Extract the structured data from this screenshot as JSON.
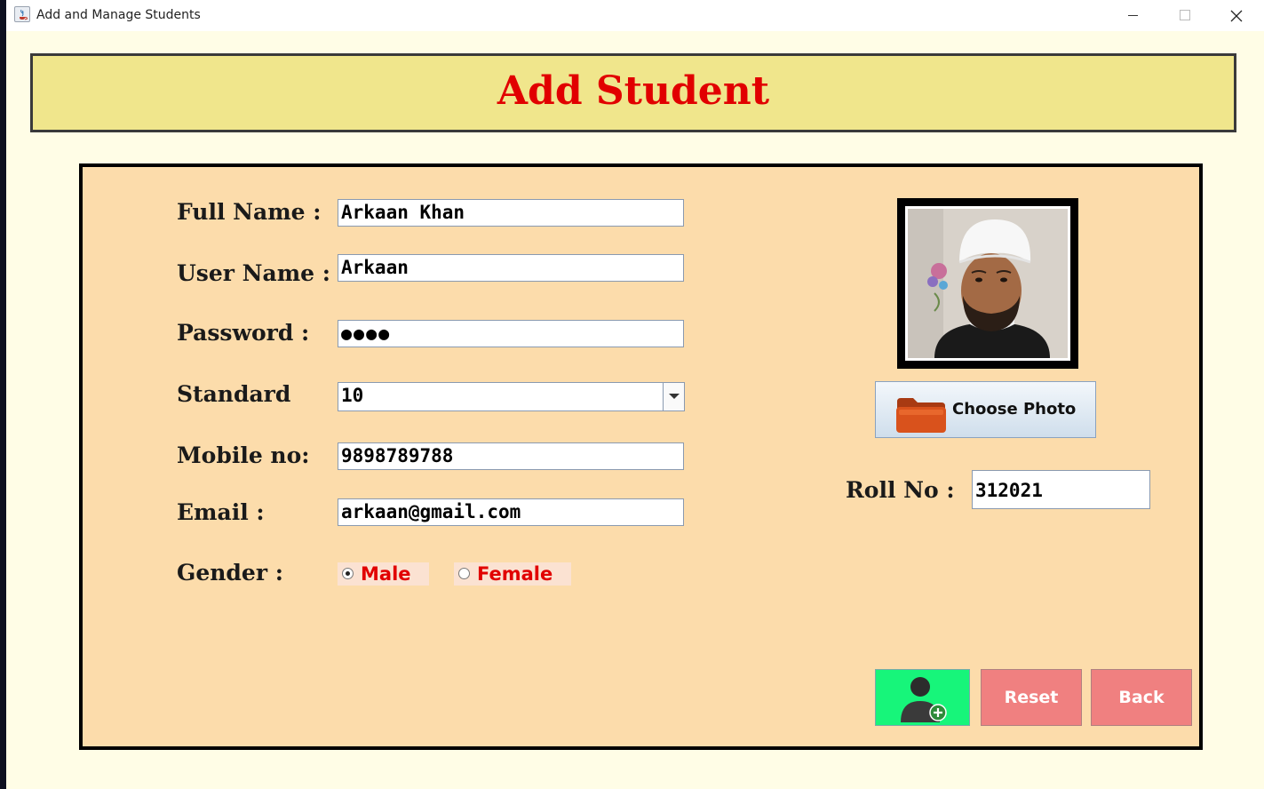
{
  "window": {
    "title": "Add and Manage Students"
  },
  "header": {
    "title": "Add Student"
  },
  "form": {
    "full_name": {
      "label": "Full Name :",
      "value": "Arkaan Khan"
    },
    "user_name": {
      "label": "User Name :",
      "value": "Arkaan"
    },
    "password": {
      "label": "Password :",
      "value": "●●●●"
    },
    "standard": {
      "label": "Standard",
      "value": "10"
    },
    "mobile": {
      "label": "Mobile no:",
      "value": "9898789788"
    },
    "email": {
      "label": "Email :",
      "value": "arkaan@gmail.com"
    },
    "gender": {
      "label": "Gender :",
      "options": [
        {
          "label": "Male",
          "selected": true
        },
        {
          "label": "Female",
          "selected": false
        }
      ]
    },
    "roll_no": {
      "label": "Roll No :",
      "value": "312021"
    }
  },
  "buttons": {
    "choose_photo": "Choose Photo",
    "reset": "Reset",
    "back": "Back"
  },
  "icons": {
    "app": "java-coffee-icon",
    "folder": "folder-icon",
    "add_student": "user-add-icon"
  },
  "colors": {
    "title_red": "#e10000",
    "banner": "#f0e68c",
    "panel": "#fcdcab",
    "window_bg": "#fffde6",
    "add_button": "#17f57a",
    "action_buttons": "#f08080"
  }
}
